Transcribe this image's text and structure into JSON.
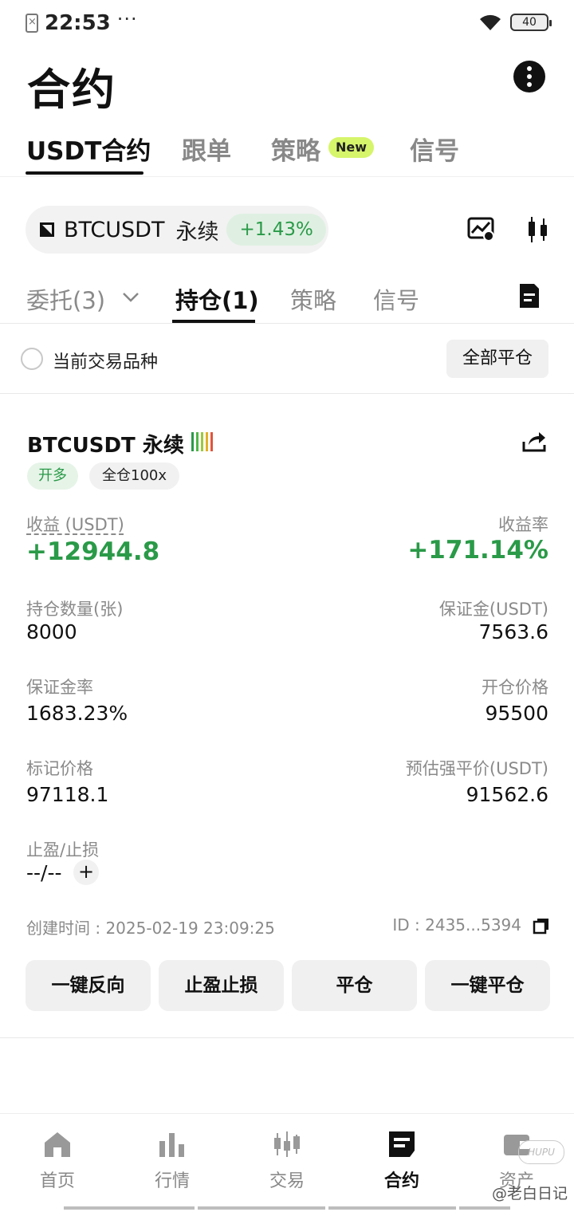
{
  "status_bar": {
    "time": "22:53",
    "dots": "···",
    "battery": "40"
  },
  "header": {
    "title": "合约"
  },
  "main_tabs": [
    {
      "label": "USDT合约",
      "active": true
    },
    {
      "label": "跟单",
      "active": false
    },
    {
      "label": "策略",
      "badge": "New",
      "active": false
    },
    {
      "label": "信号",
      "active": false
    }
  ],
  "symbol": {
    "name": "BTCUSDT",
    "type": "永续",
    "change": "+1.43%",
    "change_color": "#2a9a48"
  },
  "sub_tabs": [
    {
      "label": "委托(3)",
      "active": false
    },
    {
      "label": "持仓(1)",
      "active": true
    },
    {
      "label": "策略",
      "active": false
    },
    {
      "label": "信号",
      "active": false
    }
  ],
  "filter": {
    "label": "当前交易品种",
    "close_all": "全部平仓"
  },
  "position": {
    "title": "BTCUSDT 永续",
    "risk_colors": [
      "#2a9a48",
      "#4fb548",
      "#9bc93c",
      "#e0b12a",
      "#e2553a"
    ],
    "side": "开多",
    "leverage": "全仓100x",
    "pnl_label": "收益 (USDT)",
    "pnl_value": "+12944.8",
    "roe_label": "收益率",
    "roe_value": "+171.14%",
    "qty_label": "持仓数量(张)",
    "qty_value": "8000",
    "margin_label": "保证金(USDT)",
    "margin_value": "7563.6",
    "margin_ratio_label": "保证金率",
    "margin_ratio_value": "1683.23%",
    "entry_label": "开仓价格",
    "entry_value": "95500",
    "mark_label": "标记价格",
    "mark_value": "97118.1",
    "liq_label": "预估强平价(USDT)",
    "liq_value": "91562.6",
    "tpsl_label": "止盈/止损",
    "tpsl_value": "--/--",
    "tpsl_add": "+",
    "created": "创建时间 : 2025-02-19 23:09:25",
    "id": "ID : 2435...5394",
    "accent": "#2a9a48"
  },
  "actions": [
    "一键反向",
    "止盈止损",
    "平仓",
    "一键平仓"
  ],
  "bottom_nav": [
    {
      "label": "首页",
      "icon": "home-icon",
      "active": false
    },
    {
      "label": "行情",
      "icon": "bar-chart-icon",
      "active": false
    },
    {
      "label": "交易",
      "icon": "candlestick-icon",
      "active": false
    },
    {
      "label": "合约",
      "icon": "contract-icon",
      "active": true
    },
    {
      "label": "资产",
      "icon": "wallet-icon",
      "active": false
    }
  ],
  "watermark": {
    "text": "@老白日记",
    "logo": "HUPU"
  }
}
